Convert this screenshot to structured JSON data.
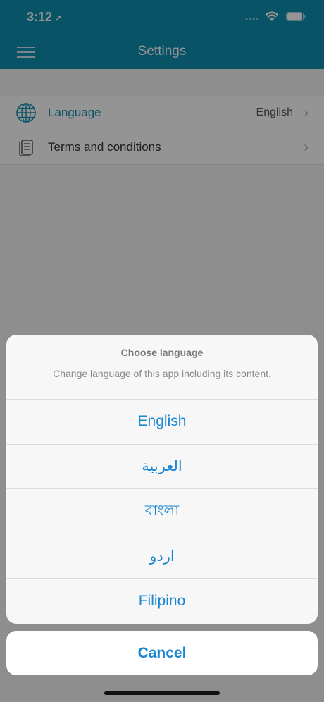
{
  "status": {
    "time": "3:12"
  },
  "nav": {
    "title": "Settings"
  },
  "settings": {
    "items": [
      {
        "label": "Language",
        "value": "English"
      },
      {
        "label": "Terms and conditions",
        "value": ""
      }
    ]
  },
  "sheet": {
    "title": "Choose language",
    "message": "Change language of this app including its content.",
    "options": [
      "English",
      "العربية",
      "বাংলা",
      "اردو",
      "Filipino"
    ],
    "cancel": "Cancel"
  },
  "colors": {
    "accent": "#118fb0",
    "action": "#1a86d1"
  }
}
